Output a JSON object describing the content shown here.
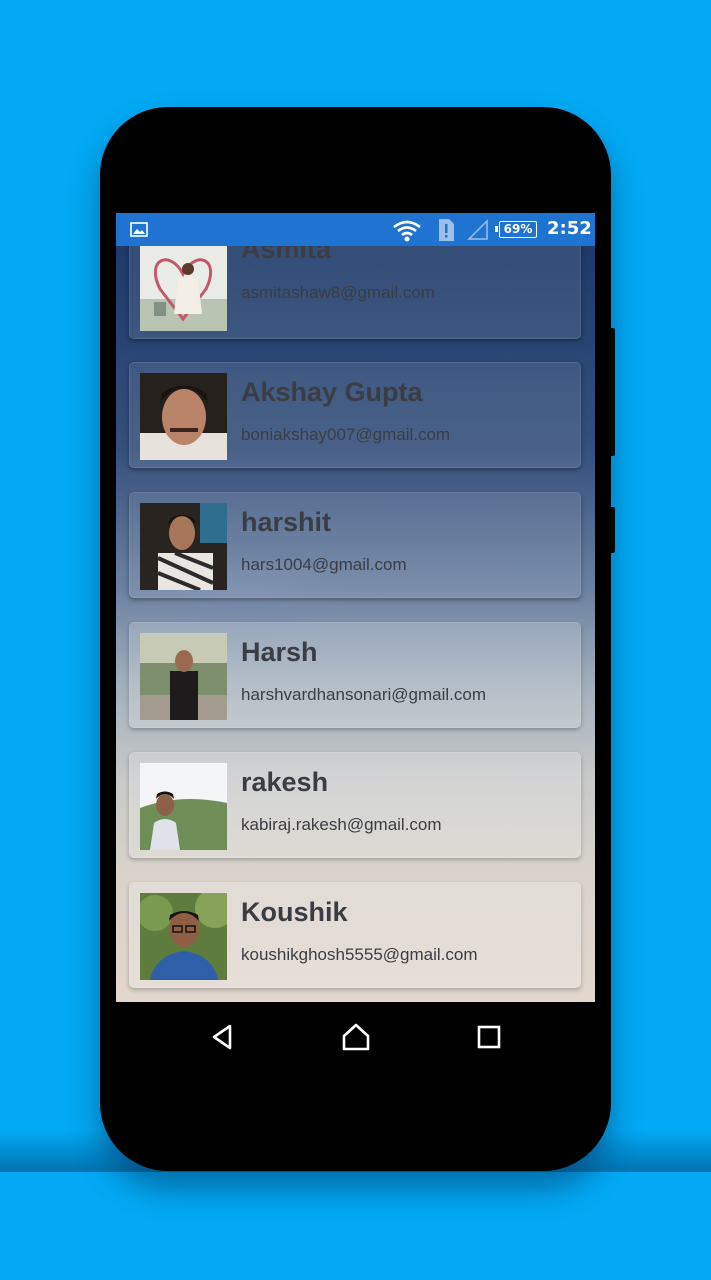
{
  "status_bar": {
    "battery": "69%",
    "time": "2:52"
  },
  "contacts": [
    {
      "name": "Asmita",
      "email": "asmitashaw8@gmail.com"
    },
    {
      "name": "Akshay Gupta",
      "email": "boniakshay007@gmail.com"
    },
    {
      "name": "harshit",
      "email": "hars1004@gmail.com"
    },
    {
      "name": "Harsh",
      "email": "harshvardhansonari@gmail.com"
    },
    {
      "name": "rakesh",
      "email": "kabiraj.rakesh@gmail.com"
    },
    {
      "name": "Koushik",
      "email": "koushikghosh5555@gmail.com"
    }
  ],
  "navigation": {
    "back_icon": "back-triangle-icon",
    "home_icon": "home-icon",
    "recents_icon": "recents-square-icon"
  }
}
